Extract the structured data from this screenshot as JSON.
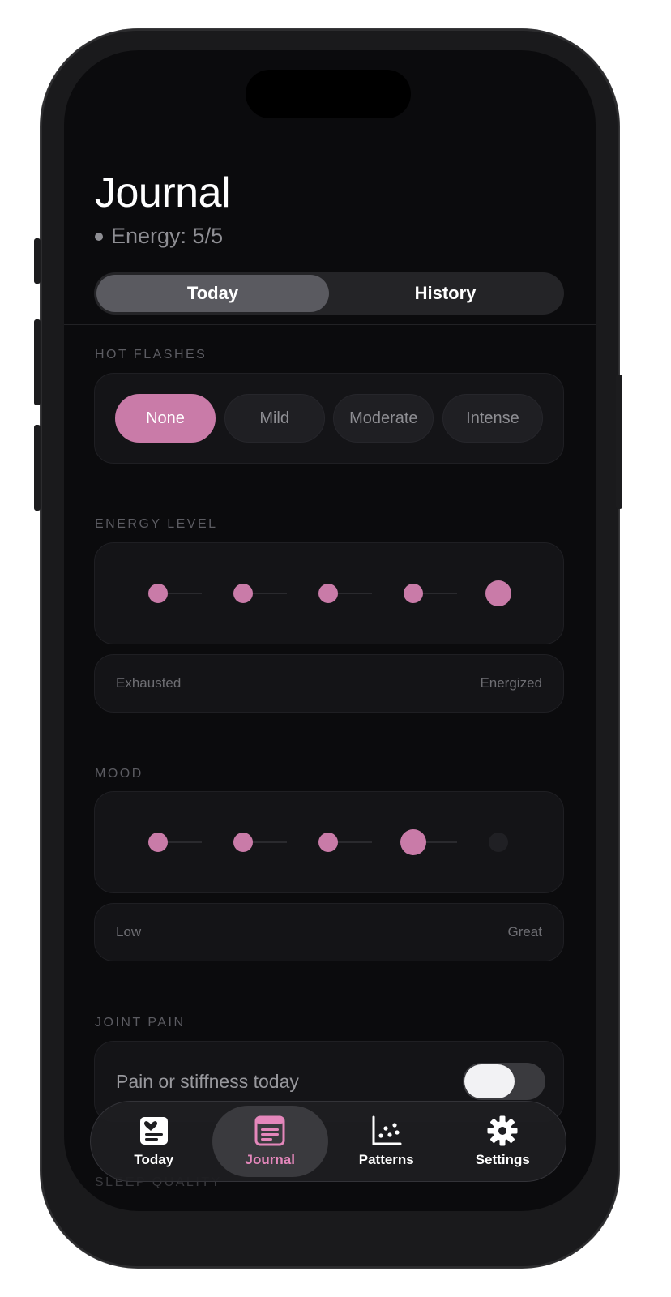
{
  "header": {
    "title": "Journal",
    "subtitle": "Energy: 5/5"
  },
  "segmented": {
    "options": [
      "Today",
      "History"
    ],
    "selected": "Today"
  },
  "hot_flashes": {
    "label": "HOT FLASHES",
    "options": [
      "None",
      "Mild",
      "Moderate",
      "Intense"
    ],
    "selected": "None"
  },
  "energy": {
    "label": "ENERGY LEVEL",
    "value": 5,
    "max": 5,
    "min_label": "Exhausted",
    "max_label": "Energized"
  },
  "mood": {
    "label": "MOOD",
    "value": 4,
    "max": 5,
    "min_label": "Low",
    "max_label": "Great"
  },
  "joint_pain": {
    "label": "JOINT PAIN",
    "toggle_label": "Pain or stiffness today",
    "toggle_on": false
  },
  "next_section": {
    "label": "SLEEP QUALITY"
  },
  "tabbar": {
    "items": [
      {
        "label": "Today",
        "icon": "heart-card-icon"
      },
      {
        "label": "Journal",
        "icon": "journal-icon"
      },
      {
        "label": "Patterns",
        "icon": "scatter-chart-icon"
      },
      {
        "label": "Settings",
        "icon": "gear-icon"
      }
    ],
    "selected": "Journal"
  },
  "colors": {
    "accent": "#c97ba8",
    "accent_text": "#e487bb",
    "background": "#0b0b0d",
    "card": "#141417"
  }
}
